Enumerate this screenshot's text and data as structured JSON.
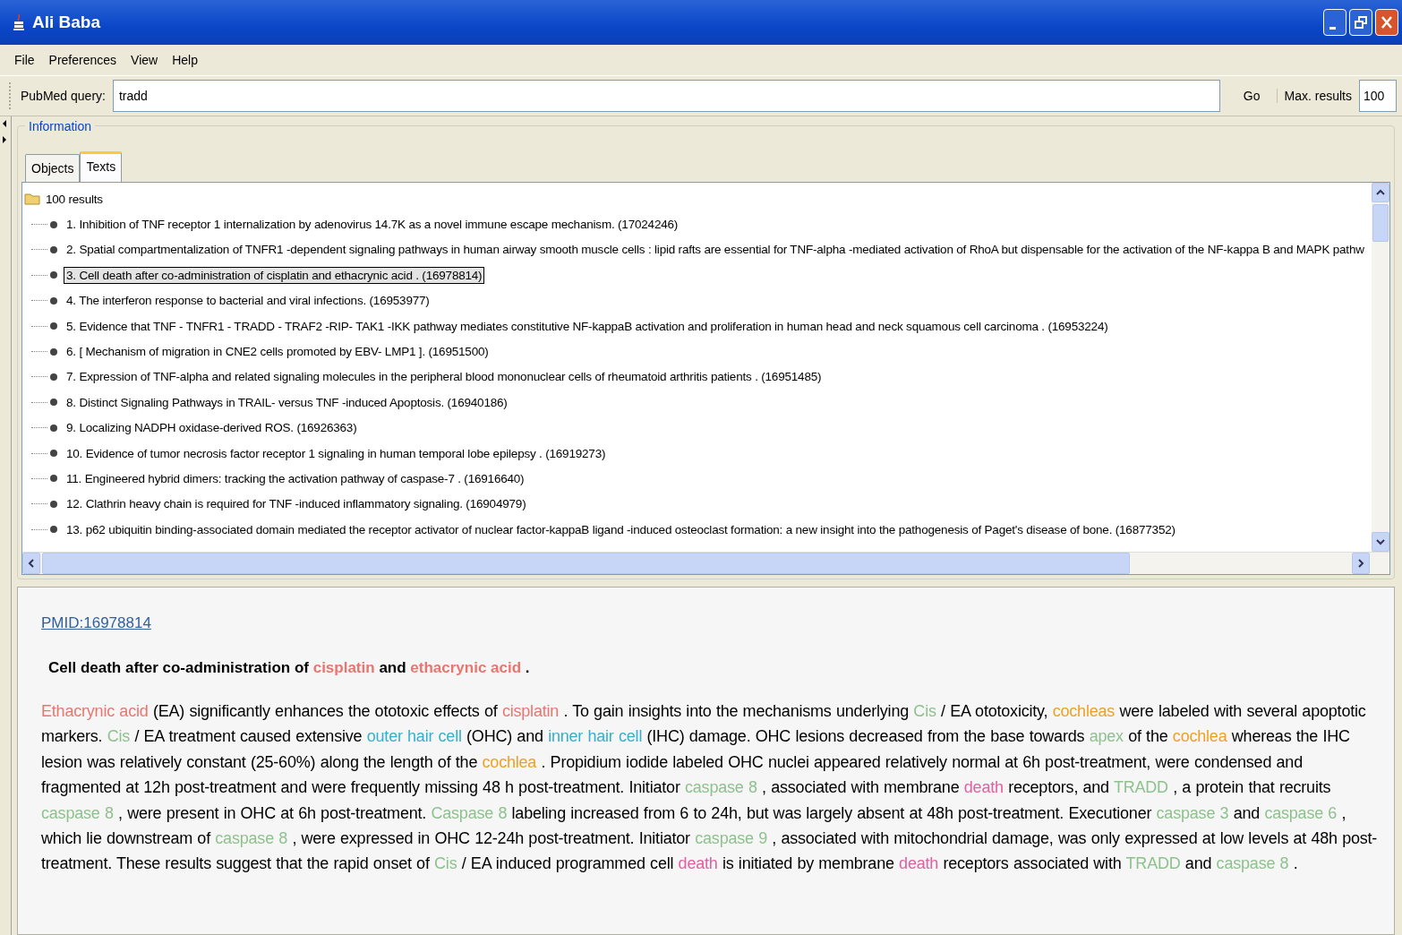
{
  "window": {
    "title": "Ali Baba"
  },
  "menu": [
    "File",
    "Preferences",
    "View",
    "Help"
  ],
  "toolbar": {
    "query_label": "PubMed query:",
    "query_value": "tradd",
    "go": "Go",
    "max_label": "Max. results",
    "max_value": "100"
  },
  "panel_title": "Information",
  "tabs": [
    {
      "label": "Objects",
      "selected": false
    },
    {
      "label": "Texts",
      "selected": true
    }
  ],
  "tree": {
    "root": "100 results",
    "items": [
      {
        "label": "1. Inhibition of TNF receptor 1 internalization by adenovirus 14.7K as a novel immune escape mechanism. (17024246)",
        "selected": false
      },
      {
        "label": "2. Spatial compartmentalization of TNFR1 -dependent signaling pathways in human airway smooth muscle cells : lipid rafts are essential for TNF-alpha -mediated activation of RhoA but dispensable for the activation of the NF-kappa B and MAPK pathw",
        "selected": false
      },
      {
        "label": "3. Cell death after co-administration of cisplatin and ethacrynic acid . (16978814)",
        "selected": true
      },
      {
        "label": "4. The interferon response to bacterial and viral infections. (16953977)",
        "selected": false
      },
      {
        "label": "5. Evidence that TNF - TNFR1 - TRADD - TRAF2 -RIP- TAK1 -IKK pathway mediates constitutive NF-kappaB activation and proliferation in human head and neck squamous cell carcinoma . (16953224)",
        "selected": false
      },
      {
        "label": "6. [ Mechanism of migration in CNE2 cells promoted by EBV- LMP1 ]. (16951500)",
        "selected": false
      },
      {
        "label": "7. Expression of TNF-alpha and related signaling molecules in the peripheral blood mononuclear cells of rheumatoid arthritis patients . (16951485)",
        "selected": false
      },
      {
        "label": "8. Distinct Signaling Pathways in TRAIL- versus TNF -induced Apoptosis. (16940186)",
        "selected": false
      },
      {
        "label": "9. Localizing NADPH oxidase-derived ROS. (16926363)",
        "selected": false
      },
      {
        "label": "10. Evidence of tumor necrosis factor receptor 1 signaling in human temporal lobe epilepsy . (16919273)",
        "selected": false
      },
      {
        "label": "11. Engineered hybrid dimers: tracking the activation pathway of caspase-7 . (16916640)",
        "selected": false
      },
      {
        "label": "12. Clathrin heavy chain is required for TNF -induced inflammatory signaling. (16904979)",
        "selected": false
      },
      {
        "label": "13. p62 ubiquitin binding-associated domain mediated the receptor activator of nuclear factor-kappaB ligand -induced osteoclast formation: a new insight into the pathogenesis of Paget's disease of bone. (16877352)",
        "selected": false
      }
    ]
  },
  "detail": {
    "link": "PMID:16978814",
    "title": [
      {
        "text": "Cell death after co-administration of"
      },
      {
        "text": "cisplatin",
        "color": "#e9766e"
      },
      {
        "text": "and"
      },
      {
        "text": "ethacrynic acid",
        "color": "#e9766e"
      },
      {
        "text": "."
      }
    ],
    "abstract": [
      {
        "text": "Ethacrynic acid",
        "color": "#e9766e"
      },
      {
        "text": "(EA) significantly enhances the ototoxic effects of"
      },
      {
        "text": "cisplatin",
        "color": "#e9766e"
      },
      {
        "text": ". To gain insights into the mechanisms underlying"
      },
      {
        "text": "Cis",
        "color": "#8fc08f"
      },
      {
        "text": "/ EA ototoxicity,"
      },
      {
        "text": "cochleas",
        "color": "#f0a020"
      },
      {
        "text": "were labeled with several apoptotic markers."
      },
      {
        "text": "Cis",
        "color": "#8fc08f"
      },
      {
        "text": "/ EA treatment caused extensive"
      },
      {
        "text": "outer hair cell",
        "color": "#33b0d0"
      },
      {
        "text": "(OHC) and"
      },
      {
        "text": "inner hair cell",
        "color": "#33b0d0"
      },
      {
        "text": "(IHC) damage. OHC lesions decreased from the base towards"
      },
      {
        "text": "apex",
        "color": "#8fc08f"
      },
      {
        "text": "of the"
      },
      {
        "text": "cochlea",
        "color": "#f0a020"
      },
      {
        "text": "whereas the IHC lesion was relatively constant (25-60%) along the length of the"
      },
      {
        "text": "cochlea",
        "color": "#f0a020"
      },
      {
        "text": ". Propidium iodide labeled OHC nuclei appeared relatively normal at 6h post-treatment, were condensed and fragmented at 12h post-treatment and were frequently missing 48 h post-treatment. Initiator"
      },
      {
        "text": "caspase 8",
        "color": "#8fc08f"
      },
      {
        "text": ", associated with membrane"
      },
      {
        "text": "death",
        "color": "#e060a0"
      },
      {
        "text": "receptors, and"
      },
      {
        "text": "TRADD",
        "color": "#8fc08f"
      },
      {
        "text": ", a protein that recruits"
      },
      {
        "text": "caspase 8",
        "color": "#8fc08f"
      },
      {
        "text": ", were present in OHC at 6h post-treatment."
      },
      {
        "text": "Caspase 8",
        "color": "#8fc08f"
      },
      {
        "text": "labeling increased from 6 to 24h, but was largely absent at 48h post-treatment. Executioner"
      },
      {
        "text": "caspase 3",
        "color": "#8fc08f"
      },
      {
        "text": "and"
      },
      {
        "text": "caspase 6",
        "color": "#8fc08f"
      },
      {
        "text": ", which lie downstream of"
      },
      {
        "text": "caspase 8",
        "color": "#8fc08f"
      },
      {
        "text": ", were expressed in OHC 12-24h post-treatment. Initiator"
      },
      {
        "text": "caspase 9",
        "color": "#8fc08f"
      },
      {
        "text": ", associated with mitochondrial damage, was only expressed at low levels at 48h post-treatment. These results suggest that the rapid onset of"
      },
      {
        "text": "Cis",
        "color": "#8fc08f"
      },
      {
        "text": "/ EA induced programmed cell"
      },
      {
        "text": "death",
        "color": "#e060a0"
      },
      {
        "text": "is initiated by membrane"
      },
      {
        "text": "death",
        "color": "#e060a0"
      },
      {
        "text": "receptors associated with"
      },
      {
        "text": "TRADD",
        "color": "#8fc08f"
      },
      {
        "text": "and"
      },
      {
        "text": "caspase 8",
        "color": "#8fc08f"
      },
      {
        "text": "."
      }
    ]
  }
}
